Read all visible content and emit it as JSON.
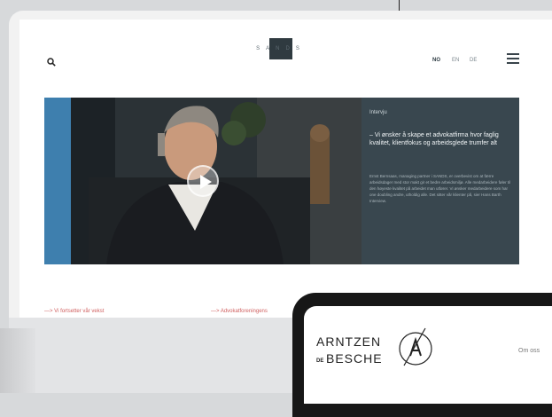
{
  "header": {
    "logo_text": "SANDS",
    "languages": [
      {
        "code": "NO",
        "active": true
      },
      {
        "code": "EN",
        "active": false
      },
      {
        "code": "DE",
        "active": false
      }
    ],
    "icons": {
      "search": "search-icon",
      "menu": "hamburger-menu-icon"
    }
  },
  "hero": {
    "tag": "Intervju",
    "quote": "– Vi ønsker å skape et advokatfirma hvor faglig kvalitet, klientfokus og arbeidsglede trumfer alt",
    "body": "Ernst Bernsaas, managing partner i SANDS, er overbevist om at færre arbeidsdager med stor makt gir et bedre arbeidsmiljø. Alle medarbeidere føler til den høyeste kvalitet på arbeidet man utfører. Vi ønsker medarbeidere som har one doubling andre, utholdig alle. Det sitter vår klienter på, sier Hans Barth Interview.",
    "video_icon": "play-icon"
  },
  "links": [
    {
      "label": "—> Vi fortsetter vår vekst"
    },
    {
      "label": "—> Advokatforeningens"
    }
  ],
  "phone": {
    "brand_line1": "ARNTZEN",
    "brand_prefix": "DE",
    "brand_line2": "BESCHE",
    "nav_label": "Om oss"
  },
  "colors": {
    "panel": "#39474f",
    "link": "#d06060",
    "logo_box": "#2f3a40"
  }
}
